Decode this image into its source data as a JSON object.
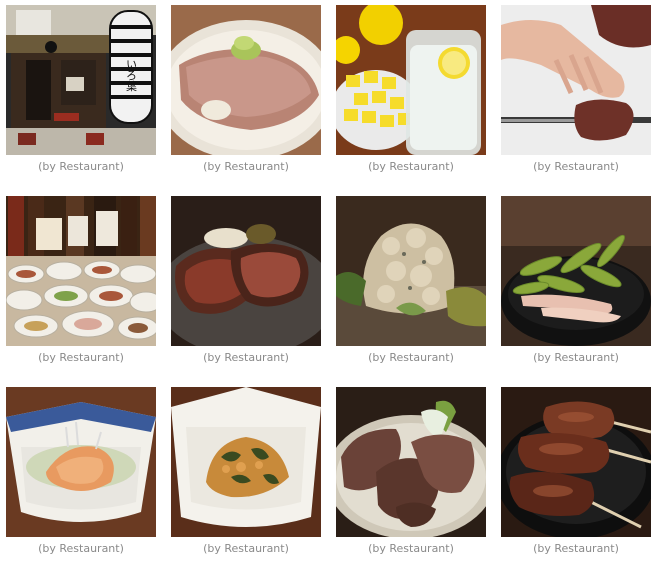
{
  "gallery": {
    "items": [
      {
        "caption": "(by Restaurant)",
        "subject": "restaurant-storefront-photo",
        "sign_text": "いろ葉"
      },
      {
        "caption": "(by Restaurant)",
        "subject": "tongue-steak-wasabi-photo"
      },
      {
        "caption": "(by Restaurant)",
        "subject": "lemon-sour-drink-photo"
      },
      {
        "caption": "(by Restaurant)",
        "subject": "slicing-meat-photo"
      },
      {
        "caption": "(by Restaurant)",
        "subject": "sake-bottles-and-dishes-photo"
      },
      {
        "caption": "(by Restaurant)",
        "subject": "grilled-tongue-slices-photo"
      },
      {
        "caption": "(by Restaurant)",
        "subject": "potato-salad-photo"
      },
      {
        "caption": "(by Restaurant)",
        "subject": "edamame-bowl-photo"
      },
      {
        "caption": "(by Restaurant)",
        "subject": "seafood-appetizer-bowl-photo"
      },
      {
        "caption": "(by Restaurant)",
        "subject": "pickled-vegetables-bowl-photo"
      },
      {
        "caption": "(by Restaurant)",
        "subject": "sliced-grilled-meat-plate-photo"
      },
      {
        "caption": "(by Restaurant)",
        "subject": "meat-skewers-photo"
      }
    ]
  }
}
